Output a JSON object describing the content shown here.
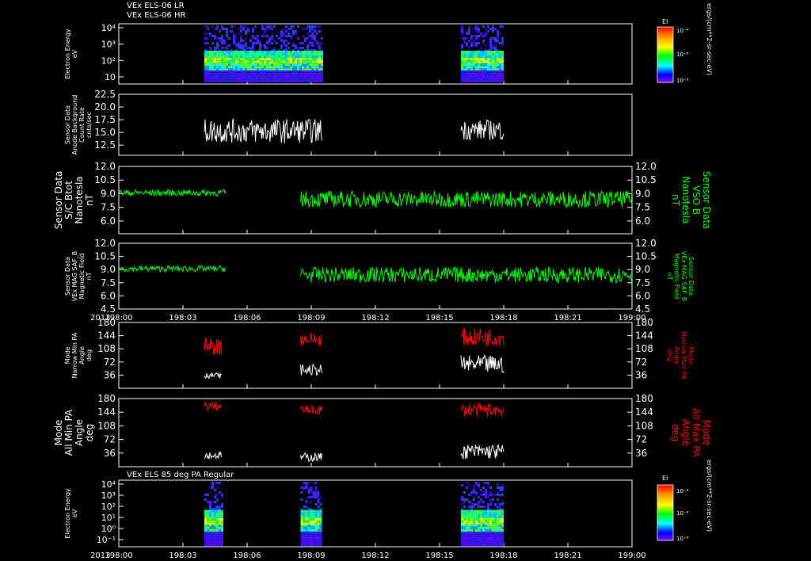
{
  "header": {
    "line1": "VEx ELS-06 LR",
    "line2": "VEx ELS-06 HR",
    "bottom_panel_title": "VEx ELS 85 deg PA Regular"
  },
  "colorbar": {
    "label": "EI",
    "units": "ergs/(cm**2-sr-sec-eV)",
    "ticks": [
      "10⁻⁴",
      "10⁻⁶",
      "10⁻⁸"
    ]
  },
  "colors": {
    "background": "#000000",
    "frame": "#ffffff",
    "white_trace": "#ffffff",
    "green_trace": "#00ff00",
    "red_trace": "#ff0000"
  },
  "time_axis": {
    "year": "2013",
    "ticks": [
      "198:00",
      "198:03",
      "198:06",
      "198:09",
      "198:12",
      "198:15",
      "198:18",
      "198:21",
      "199:00"
    ]
  },
  "chart_data": [
    {
      "type": "heatmap",
      "id": "els_lr_hr",
      "ylabel": [
        "Electron Energy",
        "eV"
      ],
      "yscale": "log",
      "yticks": [
        "10⁴",
        "10³",
        "10²",
        "10"
      ],
      "data_intervals_minutes": [
        [
          4.0,
          9.5
        ],
        [
          16.0,
          18.0
        ]
      ],
      "colorbar_ticks": [
        "10⁻⁴",
        "10⁻⁶",
        "10⁻⁸"
      ]
    },
    {
      "type": "line",
      "id": "anode_background",
      "ylabel": [
        "Sensor Data",
        "Anode Background",
        "Count Rate",
        "cnts/sec"
      ],
      "yticks": [
        "22.5",
        "20.0",
        "17.5",
        "15.0",
        "12.5"
      ],
      "ylim": [
        10.5,
        22.5
      ],
      "series": [
        {
          "color": "white",
          "segments": [
            {
              "start": 4.0,
              "end": 9.5,
              "base": 15.3,
              "amp": 2.4
            },
            {
              "start": 16.0,
              "end": 18.0,
              "base": 15.5,
              "amp": 2.0
            }
          ]
        }
      ]
    },
    {
      "type": "line",
      "id": "sc_btot",
      "ylabel": [
        "Sensor Data",
        "S/C Btot",
        "Nanotesla",
        "nT"
      ],
      "ylabel_right": [
        "Sensor Data",
        "VSO B",
        "Nanotesla",
        "nT"
      ],
      "yticks": [
        "12.0",
        "10.5",
        "9.0",
        "7.5",
        "6.0"
      ],
      "ylim": [
        4.6,
        12.0
      ],
      "series": [
        {
          "color": "green",
          "segments": [
            {
              "start": 0.0,
              "end": 5.0,
              "base": 9.1,
              "amp": 0.35
            },
            {
              "start": 8.5,
              "end": 24.0,
              "base": 8.4,
              "amp": 0.9
            }
          ]
        }
      ]
    },
    {
      "type": "line",
      "id": "mag_field",
      "ylabel": [
        "Sensor Data",
        "VEx MAG SAF_B",
        "Magnetic Field",
        "nT"
      ],
      "ylabel_right": [
        "Sensor Data",
        "VEx MAG SAF_B",
        "Magnetic Field",
        "nT"
      ],
      "yticks": [
        "12.0",
        "10.5",
        "9.0",
        "7.5",
        "6.0",
        "4.5"
      ],
      "ylim": [
        4.5,
        12.0
      ],
      "series": [
        {
          "color": "green",
          "segments": [
            {
              "start": 0.0,
              "end": 5.0,
              "base": 9.1,
              "amp": 0.35
            },
            {
              "start": 8.5,
              "end": 24.0,
              "base": 8.4,
              "amp": 0.9
            }
          ]
        }
      ]
    },
    {
      "type": "line",
      "id": "narrow_pa",
      "ylabel": [
        "Mode",
        "Narrow Min PA",
        "Angle",
        "deg"
      ],
      "ylabel_right": [
        "Mode",
        "Narrow Max PA",
        "Angle",
        "deg"
      ],
      "yticks": [
        "180",
        "144",
        "108",
        "72",
        "36"
      ],
      "ylim": [
        0,
        180
      ],
      "series": [
        {
          "color": "white",
          "segments": [
            {
              "start": 4.0,
              "end": 4.8,
              "base": 35,
              "amp": 8
            },
            {
              "start": 8.5,
              "end": 9.5,
              "base": 50,
              "amp": 15
            },
            {
              "start": 16.0,
              "end": 18.0,
              "base": 65,
              "amp": 25
            }
          ]
        },
        {
          "color": "red",
          "segments": [
            {
              "start": 4.0,
              "end": 4.8,
              "base": 115,
              "amp": 25
            },
            {
              "start": 8.5,
              "end": 9.5,
              "base": 135,
              "amp": 18
            },
            {
              "start": 16.0,
              "end": 18.0,
              "base": 140,
              "amp": 25
            }
          ]
        }
      ]
    },
    {
      "type": "line",
      "id": "all_pa",
      "ylabel": [
        "Mode",
        "All Min PA",
        "Angle",
        "deg"
      ],
      "ylabel_right": [
        "Mode",
        "All Max PA",
        "Angle",
        "deg"
      ],
      "yticks": [
        "180",
        "144",
        "108",
        "72",
        "36"
      ],
      "ylim": [
        0,
        180
      ],
      "series": [
        {
          "color": "white",
          "segments": [
            {
              "start": 4.0,
              "end": 4.8,
              "base": 30,
              "amp": 10
            },
            {
              "start": 8.5,
              "end": 9.5,
              "base": 25,
              "amp": 12
            },
            {
              "start": 16.0,
              "end": 18.0,
              "base": 40,
              "amp": 20
            }
          ]
        },
        {
          "color": "red",
          "segments": [
            {
              "start": 4.0,
              "end": 4.8,
              "base": 160,
              "amp": 12
            },
            {
              "start": 8.5,
              "end": 9.5,
              "base": 150,
              "amp": 12
            },
            {
              "start": 16.0,
              "end": 18.0,
              "base": 150,
              "amp": 18
            }
          ]
        }
      ]
    },
    {
      "type": "heatmap",
      "id": "els_85deg",
      "ylabel": [
        "Electron Energy",
        "eV"
      ],
      "yscale": "log",
      "yticks": [
        "10⁴",
        "10³",
        "10²",
        "10¹",
        "10⁰",
        "10⁻¹"
      ],
      "data_intervals_minutes": [
        [
          4.0,
          4.8
        ],
        [
          8.5,
          9.5
        ],
        [
          16.0,
          18.0
        ]
      ],
      "colorbar_ticks": [
        "10⁻⁴",
        "10⁻⁶",
        "10⁻⁸"
      ]
    }
  ]
}
